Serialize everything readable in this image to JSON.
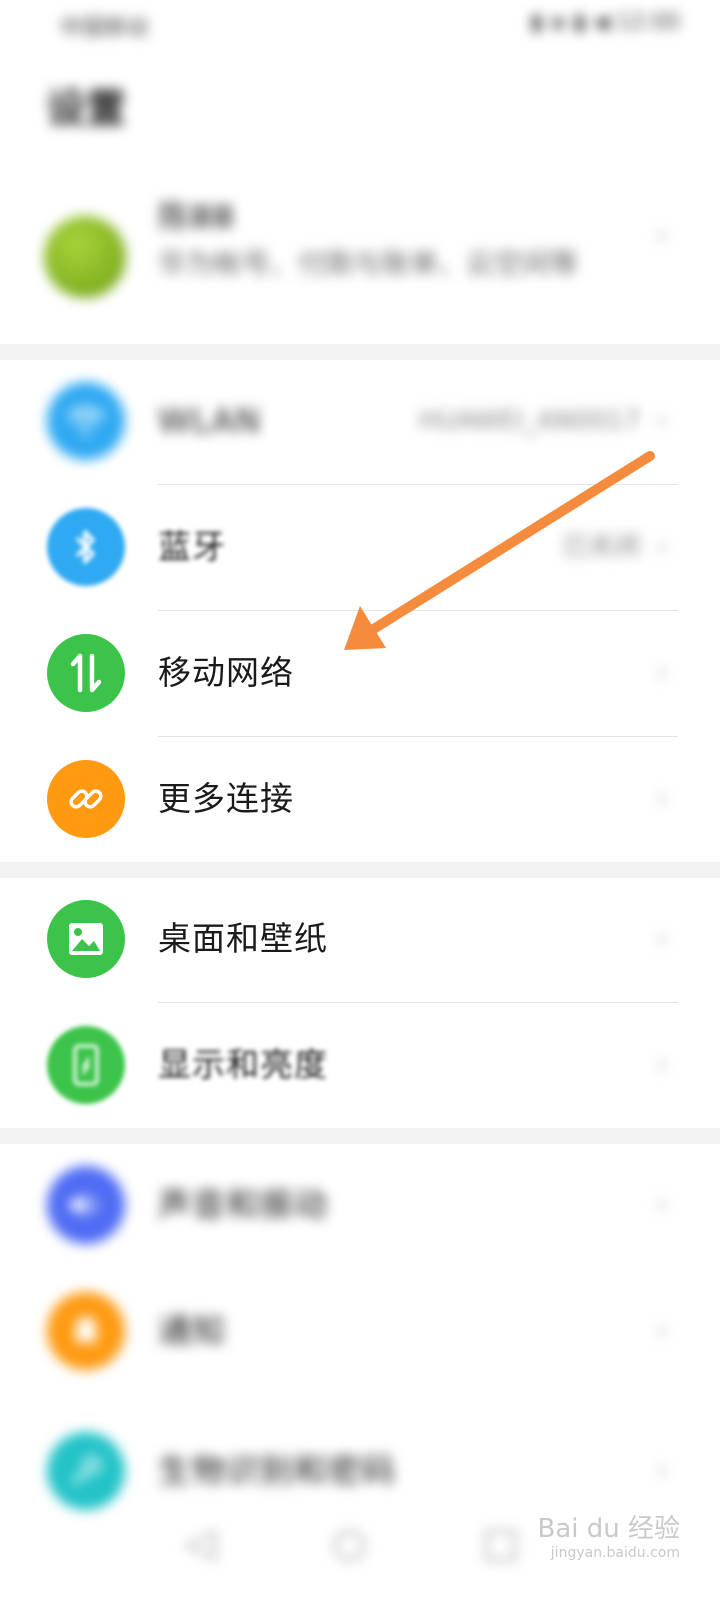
{
  "status_bar": {
    "left": "中国移动 ",
    "right": "▮ ◈ ▮ ◀ 12:00"
  },
  "header": {
    "title": "设置"
  },
  "profile": {
    "name": "陈ⅢⅢ",
    "description": "华为帐号、付款与账单、云空间等"
  },
  "sections": {
    "network": [
      {
        "id": "wlan",
        "label": "WLAN",
        "value": "HUAWEI_AN0017",
        "icon": "wifi-icon",
        "color": "#2fa9f2"
      },
      {
        "id": "bluetooth",
        "label": "蓝牙",
        "value": "已关闭",
        "icon": "bluetooth-icon",
        "color": "#2fa9f2"
      },
      {
        "id": "mobile-network",
        "label": "移动网络",
        "value": "",
        "icon": "mobile-data-icon",
        "color": "#3cc44a"
      },
      {
        "id": "more-connections",
        "label": "更多连接",
        "value": "",
        "icon": "link-icon",
        "color": "#ff9a12"
      }
    ],
    "display": [
      {
        "id": "wallpaper",
        "label": "桌面和壁纸",
        "icon": "image-icon",
        "color": "#3cc44a"
      },
      {
        "id": "display",
        "label": "显示和亮度",
        "icon": "phone-brightness-icon",
        "color": "#3cc44a"
      }
    ],
    "other": [
      {
        "id": "sound",
        "label": "声音和振动",
        "icon": "speaker-icon",
        "color": "#4f6cf4"
      },
      {
        "id": "notifications",
        "label": "通知",
        "icon": "bell-icon",
        "color": "#ff9a12"
      },
      {
        "id": "biometrics",
        "label": "生物识别和密码",
        "icon": "key-icon",
        "color": "#23c3c8"
      }
    ]
  },
  "chevron": "›",
  "nav": {
    "back": "◁",
    "home": "○",
    "recent": "□"
  },
  "watermark": {
    "brand": "Bai du 经验",
    "url": "jingyan.baidu.com"
  },
  "colors": {
    "arrow": "#f58b3c",
    "divider": "#e4e4e4"
  }
}
